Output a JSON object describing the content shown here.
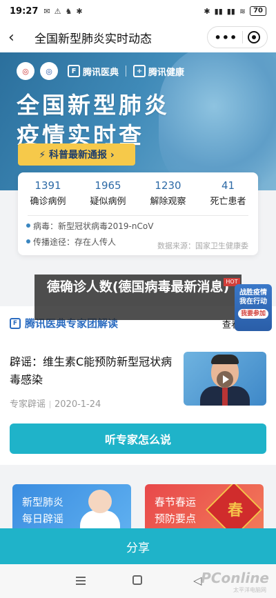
{
  "status": {
    "time": "19:27",
    "left_icons": [
      "✉",
      "⚠",
      "♞",
      "✱"
    ],
    "right_icons": [
      "✱",
      "▮▮",
      "▮▮",
      "≋"
    ],
    "battery": "70"
  },
  "nav": {
    "back_icon": "‹",
    "title": "全国新型肺炎实时动态",
    "more_icon": "•••",
    "close_icon": "◉"
  },
  "hero": {
    "logo1": "◎",
    "logo2": "◎",
    "brand1": "腾讯医典",
    "brand2": "腾讯健康",
    "title_line1": "全国新型肺炎",
    "title_line2": "疫情实时查",
    "button": "⚡ 科普最新通报 ›"
  },
  "stats": {
    "items": [
      {
        "value": "1391",
        "label": "确诊病例"
      },
      {
        "value": "1965",
        "label": "疑似病例"
      },
      {
        "value": "1230",
        "label": "解除观察"
      },
      {
        "value": "41",
        "label": "死亡患者"
      }
    ],
    "virus_line": "病毒：新型冠状病毒2019-nCoV",
    "route_line": "传播途径：存在人传人",
    "source": "数据来源：国家卫生健康委"
  },
  "overlay": {
    "headline": "德确诊人数(德国病毒最新消息)",
    "hot_label": "HOT"
  },
  "side_badge": {
    "line1": "战胜疫情",
    "line2": "我在行动",
    "join": "我要参加"
  },
  "expert": {
    "section_title": "腾讯医典专家团解读",
    "view_all": "查看",
    "article_title": "辟谣：维生素C能预防新型冠状病毒感染",
    "article_tag": "专家辟谣",
    "article_date": "2020-1-24",
    "ask_button": "听专家怎么说"
  },
  "tiles": [
    {
      "line1": "新型肺炎",
      "line2": "每日辟谣"
    },
    {
      "line1": "春节春运",
      "line2": "预防要点",
      "badge": "春"
    }
  ],
  "share": "分享",
  "watermark": {
    "brand": "PConline",
    "sub": "太平洋电脑网"
  }
}
